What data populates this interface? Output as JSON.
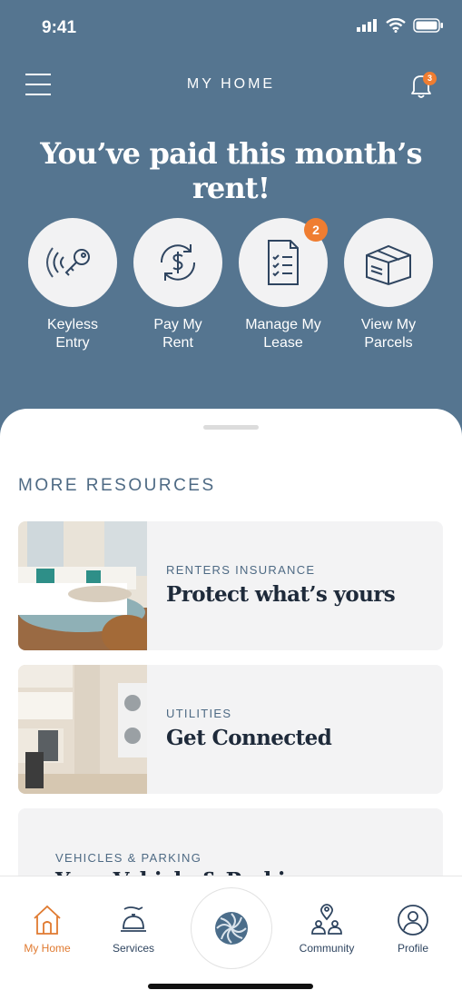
{
  "status_bar": {
    "time": "9:41"
  },
  "header": {
    "title": "MY HOME",
    "notification_count": "3"
  },
  "headline": "You’ve paid this month’s rent!",
  "quick_actions": [
    {
      "line1": "Keyless",
      "line2": "Entry",
      "icon": "key-icon"
    },
    {
      "line1": "Pay My",
      "line2": "Rent",
      "icon": "dollar-cycle-icon"
    },
    {
      "line1": "Manage My",
      "line2": "Lease",
      "icon": "checklist-icon",
      "badge": "2"
    },
    {
      "line1": "View My",
      "line2": "Parcels",
      "icon": "parcel-box-icon"
    }
  ],
  "resources": {
    "title": "MORE RESOURCES",
    "cards": [
      {
        "kicker": "RENTERS INSURANCE",
        "title": "Protect what’s yours"
      },
      {
        "kicker": "UTILITIES",
        "title": "Get Connected"
      },
      {
        "kicker": "VEHICLES & PARKING",
        "title": "Your Vehicle & Parking"
      }
    ]
  },
  "tabs": [
    {
      "label": "My Home",
      "icon": "home-icon",
      "active": true
    },
    {
      "label": "Services",
      "icon": "service-bell-icon"
    },
    {
      "label": "",
      "icon": "brand-logo-icon"
    },
    {
      "label": "Community",
      "icon": "community-icon"
    },
    {
      "label": "Profile",
      "icon": "profile-icon"
    }
  ],
  "colors": {
    "brand_blue": "#557590",
    "accent_orange": "#ef7d31",
    "card_bg": "#f3f3f4"
  }
}
